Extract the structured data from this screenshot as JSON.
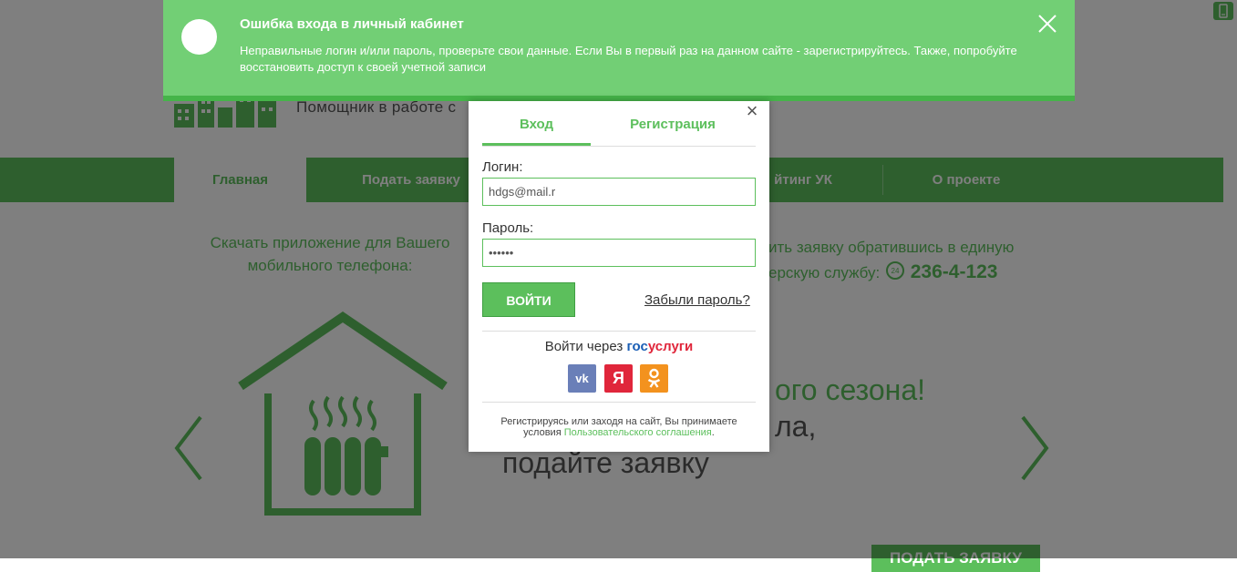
{
  "colors": {
    "brand_green": "#5cbf5c",
    "alert_green": "#72cf75",
    "overlay": "rgba(0,0,0,0.5)",
    "vk_blue": "#6a7fb8",
    "yandex_red": "#e0263b",
    "ok_orange": "#f3921e"
  },
  "header": {
    "tagline": "Помощник в работе с"
  },
  "nav": {
    "items": [
      {
        "label": "Главная",
        "active": true
      },
      {
        "label": "Подать заявку"
      },
      {
        "label": "йтинг УК"
      },
      {
        "label": "О проекте"
      }
    ]
  },
  "promo": {
    "app_text": "Скачать приложение для Вашего мобильного телефона:",
    "service_line1": "ить заявку обратившись в единую",
    "service_line2": "ерскую службу:",
    "phone": "236-4-123"
  },
  "slide": {
    "line1": "ого сезона!",
    "line2": "ла,",
    "line3": "подайте заявку",
    "cta": "ПОДАТЬ ЗАЯВКУ"
  },
  "alert": {
    "title": "Ошибка входа в личный кабинет",
    "message": "Неправильные логин и/или пароль, проверьте свои данные. Если Вы в первый раз на данном сайте - зарегистрируйтесь. Также, попробуйте восстановить доступ к своей учетной записи",
    "close_icon": "close-icon"
  },
  "modal": {
    "tabs": [
      "Вход",
      "Регистрация"
    ],
    "login_label": "Логин:",
    "login_value": "hdgs@mail.r",
    "password_label": "Пароль:",
    "password_value": "••••••",
    "submit_label": "ВОЙТИ",
    "forgot_label": "Забыли пароль?",
    "via_text": "Войти через",
    "gosuslugi_a": "гос",
    "gosuslugi_b": "услуги",
    "social": [
      "vk-icon",
      "yandex-icon",
      "odnoklassniki-icon"
    ],
    "terms_text": "Регистрируясь или заходя на сайт, Вы принимаете условия",
    "terms_link": "Пользовательского соглашения",
    "terms_end": "."
  }
}
